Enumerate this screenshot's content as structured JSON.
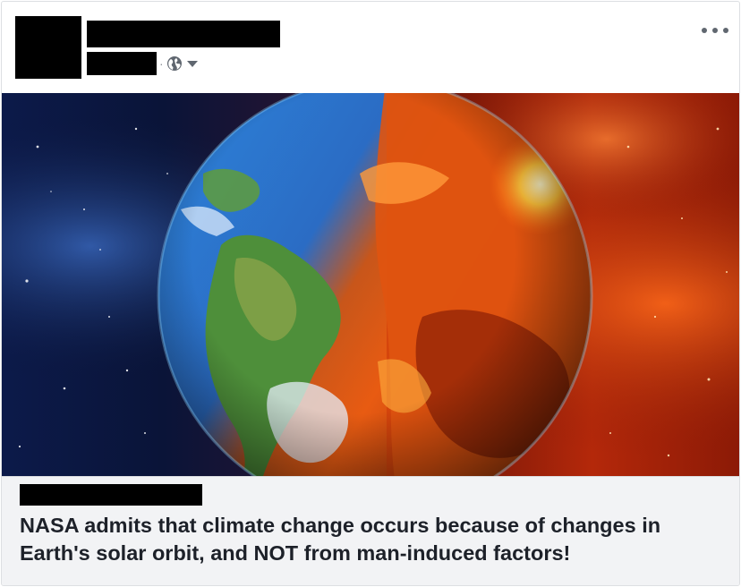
{
  "post": {
    "author_name": "",
    "timestamp": "",
    "meta_separator": "·",
    "privacy_icon": "globe-icon",
    "privacy_dropdown_icon": "caret-down-icon",
    "more_icon": "more-options-icon"
  },
  "image": {
    "subject": "earth-half-burning-image"
  },
  "link_preview": {
    "source": "",
    "headline": "NASA admits that climate change occurs because of changes in Earth's solar orbit, and NOT from man-induced factors!"
  },
  "colors": {
    "border": "#dddfe2",
    "preview_bg": "#f2f3f5",
    "headline": "#1d2129",
    "icon": "#606770"
  }
}
